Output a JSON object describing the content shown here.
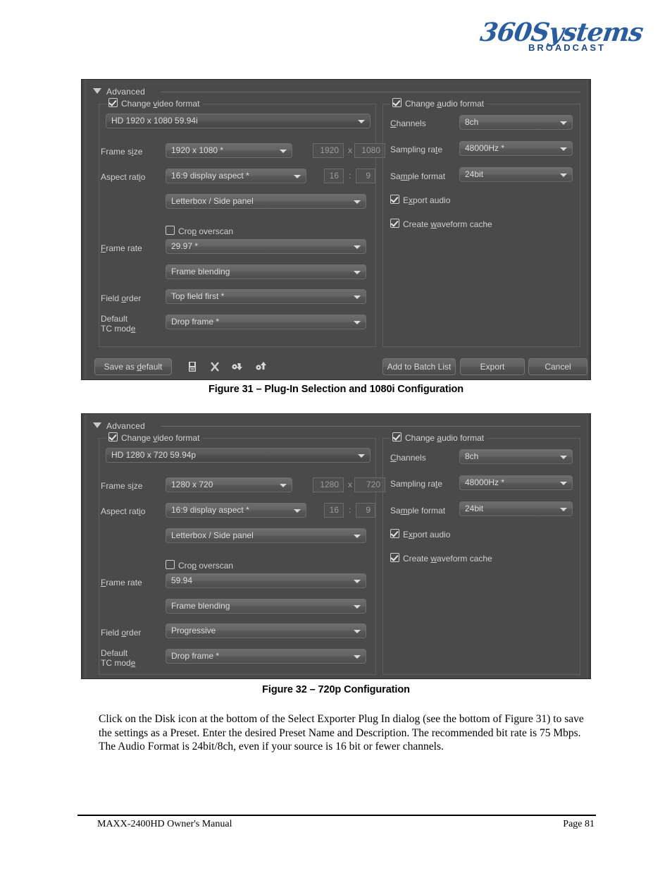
{
  "logo": {
    "brand": "360Systems",
    "sub": "BROADCAST"
  },
  "dialog1": {
    "advanced_label": "Advanced",
    "video_group": {
      "title": "Change video format",
      "title_pre": "Change ",
      "title_key": "v",
      "title_post": "ideo format",
      "preset": "HD 1920 x 1080 59.94i",
      "frame_size_label_pre": "Frame s",
      "frame_size_label_key": "i",
      "frame_size_label_post": "ze",
      "frame_size_label": "Frame size",
      "frame_size_value": "1920 x 1080 *",
      "frame_width": "1920",
      "frame_x": "x",
      "frame_height": "1080",
      "aspect_label_pre": "Aspect rat",
      "aspect_label_key": "i",
      "aspect_label_post": "o",
      "aspect_label": "Aspect ratio",
      "aspect_value": "16:9 display aspect *",
      "aspect_num": "16",
      "aspect_colon": ":",
      "aspect_den": "9",
      "scaling_value": "Letterbox / Side panel",
      "crop_label_pre": "Cro",
      "crop_label_key": "p",
      "crop_label_post": " overscan",
      "crop_label": "Crop overscan",
      "frame_rate_label_pre": "",
      "frame_rate_label_key": "F",
      "frame_rate_label_post": "rame rate",
      "frame_rate_label": "Frame rate",
      "frame_rate_value": "29.97 *",
      "blending_value": "Frame blending",
      "field_order_label_pre": "Field ",
      "field_order_label_key": "o",
      "field_order_label_post": "rder",
      "field_order_label": "Field order",
      "field_order_value": "Top field first *",
      "tc_label_line1": "Default",
      "tc_label_line2_pre": "TC mod",
      "tc_label_line2_key": "e",
      "tc_label_line2_post": "",
      "tc_label": "Default TC mode",
      "tc_value": "Drop frame *"
    },
    "audio_group": {
      "title_pre": "Change ",
      "title_key": "a",
      "title_post": "udio format",
      "title": "Change audio format",
      "channels_label_pre": "",
      "channels_label_key": "C",
      "channels_label_post": "hannels",
      "channels_label": "Channels",
      "channels_value": "8ch",
      "sampling_label_pre": "Sampling ra",
      "sampling_label_key": "t",
      "sampling_label_post": "e",
      "sampling_label": "Sampling rate",
      "sampling_value": "48000Hz *",
      "sample_format_label_pre": "Sa",
      "sample_format_label_key": "m",
      "sample_format_label_post": "ple format",
      "sample_format_label": "Sample format",
      "sample_format_value": "24bit",
      "export_audio_pre": "E",
      "export_audio_key": "x",
      "export_audio_post": "port audio",
      "export_audio": "Export audio",
      "waveform_pre": "Create ",
      "waveform_key": "w",
      "waveform_post": "aveform cache",
      "waveform": "Create waveform cache"
    },
    "buttons": {
      "save_as_default_pre": "Save as ",
      "save_as_default_key": "d",
      "save_as_default_post": "efault",
      "save_as_default": "Save as default",
      "add_to_batch": "Add to Batch List",
      "export": "Export",
      "cancel": "Cancel"
    },
    "icons": {
      "save_preset": "floppy-disk-icon",
      "delete_preset": "x-delete-icon",
      "import_preset": "import-preset-icon",
      "export_preset": "export-preset-icon"
    }
  },
  "dialog2": {
    "advanced_label": "Advanced",
    "video_group": {
      "title_pre": "Change ",
      "title_key": "v",
      "title_post": "ideo format",
      "title": "Change video format",
      "preset": "HD 1280 x 720 59.94p",
      "frame_size_label": "Frame size",
      "frame_size_value": "1280 x 720",
      "frame_width": "1280",
      "frame_x": "x",
      "frame_height": "720",
      "aspect_label": "Aspect ratio",
      "aspect_value": "16:9 display aspect *",
      "aspect_num": "16",
      "aspect_colon": ":",
      "aspect_den": "9",
      "scaling_value": "Letterbox / Side panel",
      "crop_label": "Crop overscan",
      "frame_rate_label": "Frame rate",
      "frame_rate_value": "59.94",
      "blending_value": "Frame blending",
      "field_order_label": "Field order",
      "field_order_value": "Progressive",
      "tc_label_line1": "Default",
      "tc_label_line2": "TC mode",
      "tc_value": "Drop frame *"
    },
    "audio_group": {
      "title": "Change audio format",
      "channels_label": "Channels",
      "channels_value": "8ch",
      "sampling_label": "Sampling rate",
      "sampling_value": "48000Hz *",
      "sample_format_label": "Sample format",
      "sample_format_value": "24bit",
      "export_audio": "Export audio",
      "waveform": "Create waveform cache"
    }
  },
  "captions": {
    "figure31": "Figure 31 – Plug-In Selection and 1080i Configuration",
    "figure32": "Figure 32 – 720p Configuration"
  },
  "body": {
    "paragraph": "Click on the Disk icon at the bottom of the Select Exporter Plug In dialog (see the bottom of Figure 31) to save the settings as a Preset.  Enter the desired Preset Name and Description.  The recommended bit rate is 75 Mbps.  The Audio Format is 24bit/8ch, even if your source is 16 bit or fewer channels."
  },
  "footer": {
    "left": "MAXX-2400HD Owner's Manual",
    "right": "Page 81"
  },
  "colors": {
    "dialog_bg": "#4a4a4a",
    "group_border": "#5e5e5e",
    "text": "#d2d2d2",
    "brand_blue": "#2a5d9e"
  }
}
